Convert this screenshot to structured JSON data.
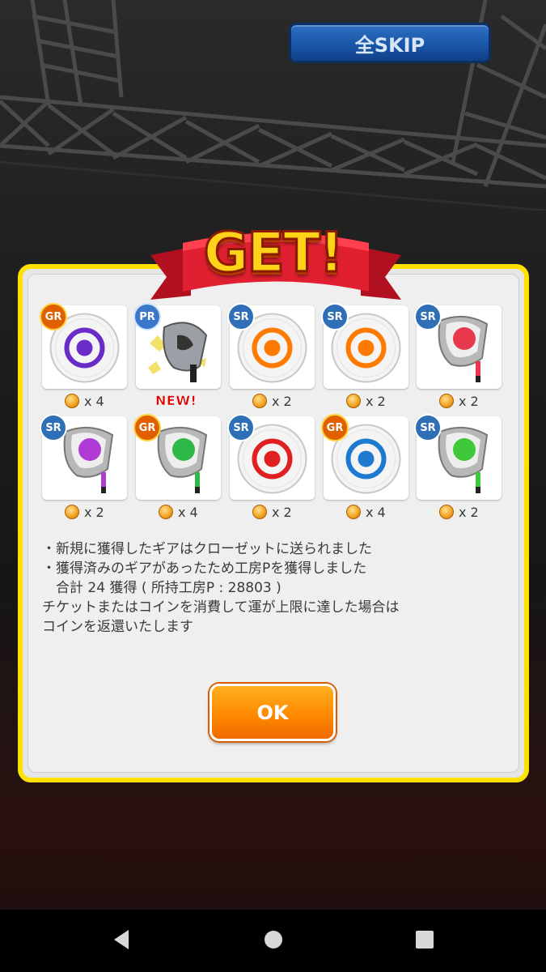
{
  "header": {
    "skip_label": "全SKIP"
  },
  "banner": {
    "title": "GET!"
  },
  "items": [
    {
      "rank": "GR",
      "kind": "ball",
      "color": "#6a2cc8",
      "qty": "x 4",
      "new": false
    },
    {
      "rank": "PR",
      "kind": "club-silver",
      "color": "#444444",
      "qty": "",
      "new": true
    },
    {
      "rank": "SR",
      "kind": "ball",
      "color": "#ff7a00",
      "qty": "x 2",
      "new": false
    },
    {
      "rank": "SR",
      "kind": "ball",
      "color": "#ff7a00",
      "qty": "x 2",
      "new": false
    },
    {
      "rank": "SR",
      "kind": "club",
      "color": "#e8384c",
      "qty": "x 2",
      "new": false
    },
    {
      "rank": "SR",
      "kind": "club",
      "color": "#b03ad6",
      "qty": "x 2",
      "new": false
    },
    {
      "rank": "GR",
      "kind": "club",
      "color": "#2eb84a",
      "qty": "x 4",
      "new": false
    },
    {
      "rank": "SR",
      "kind": "ball",
      "color": "#e02020",
      "qty": "x 2",
      "new": false
    },
    {
      "rank": "GR",
      "kind": "ball",
      "color": "#1e7ad0",
      "qty": "x 4",
      "new": false
    },
    {
      "rank": "SR",
      "kind": "club",
      "color": "#3ec83a",
      "qty": "x 2",
      "new": false
    }
  ],
  "new_label": "NEW!",
  "message": {
    "line1": "・新規に獲得したギアはクローゼットに送られました",
    "line2": "・獲得済みのギアがあったため工房Pを獲得しました",
    "line3": "　合計 24 獲得 ( 所持工房P : 28803 )",
    "line4": "チケットまたはコインを消費して運が上限に達した場合は",
    "line5": "コインを返還いたします"
  },
  "ok_label": "OK",
  "colors": {
    "dialog_border": "#ffe100",
    "ok_button": "#ff8a00",
    "skip_button": "#1a56a8"
  }
}
